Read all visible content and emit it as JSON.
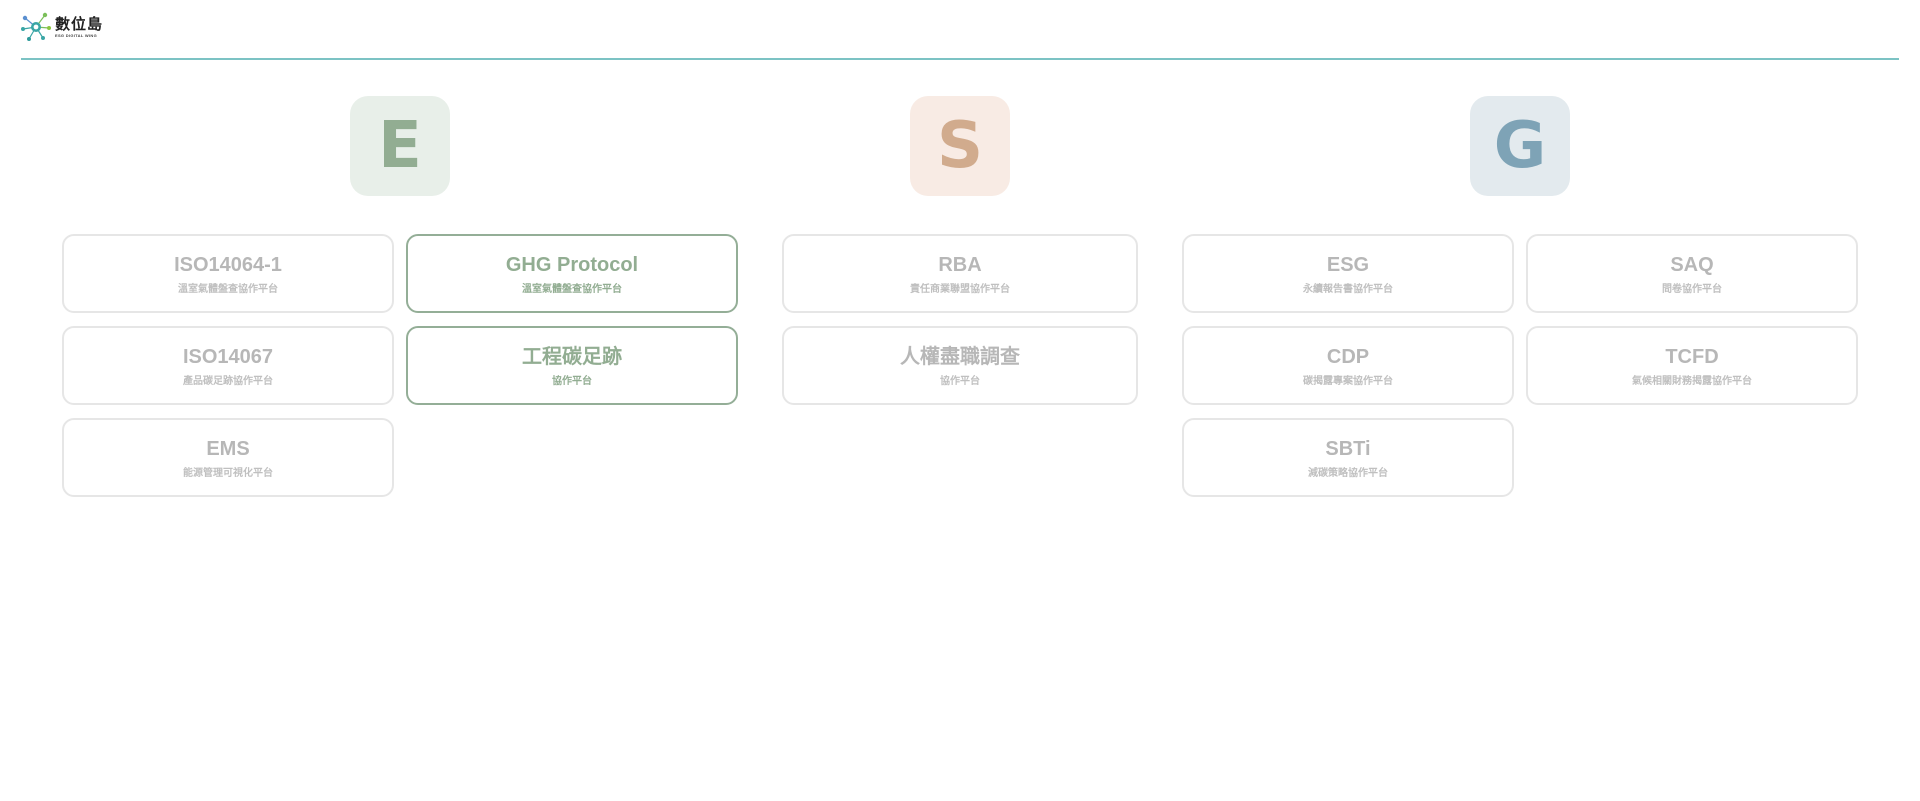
{
  "header": {
    "logo_name": "數位島",
    "logo_sub": "ESG DIGITAL WING"
  },
  "colors": {
    "header_rule": "#7cc3c4",
    "environment": "#92ad92",
    "social": "#d1ab8d",
    "governance": "#7ea3b6",
    "active_border": "#94ae97",
    "inactive_text": "#b7b7b7"
  },
  "categories": {
    "e": "E",
    "s": "S",
    "g": "G"
  },
  "environment": {
    "iso14064": {
      "title": "ISO14064-1",
      "subtitle": "溫室氣體盤查協作平台"
    },
    "ghg": {
      "title": "GHG Protocol",
      "subtitle": "溫室氣體盤查協作平台"
    },
    "iso14067": {
      "title": "ISO14067",
      "subtitle": "產品碳足跡協作平台"
    },
    "engineering": {
      "title": "工程碳足跡",
      "subtitle": "協作平台"
    },
    "ems": {
      "title": "EMS",
      "subtitle": "能源管理可視化平台"
    }
  },
  "social": {
    "rba": {
      "title": "RBA",
      "subtitle": "責任商業聯盟協作平台"
    },
    "human_rights": {
      "title": "人權盡職調查",
      "subtitle": "協作平台"
    }
  },
  "governance": {
    "esg": {
      "title": "ESG",
      "subtitle": "永續報告書協作平台"
    },
    "saq": {
      "title": "SAQ",
      "subtitle": "問卷協作平台"
    },
    "cdp": {
      "title": "CDP",
      "subtitle": "碳揭露專案協作平台"
    },
    "tcfd": {
      "title": "TCFD",
      "subtitle": "氣候相關財務揭露協作平台"
    },
    "sbti": {
      "title": "SBTi",
      "subtitle": "減碳策略協作平台"
    }
  }
}
